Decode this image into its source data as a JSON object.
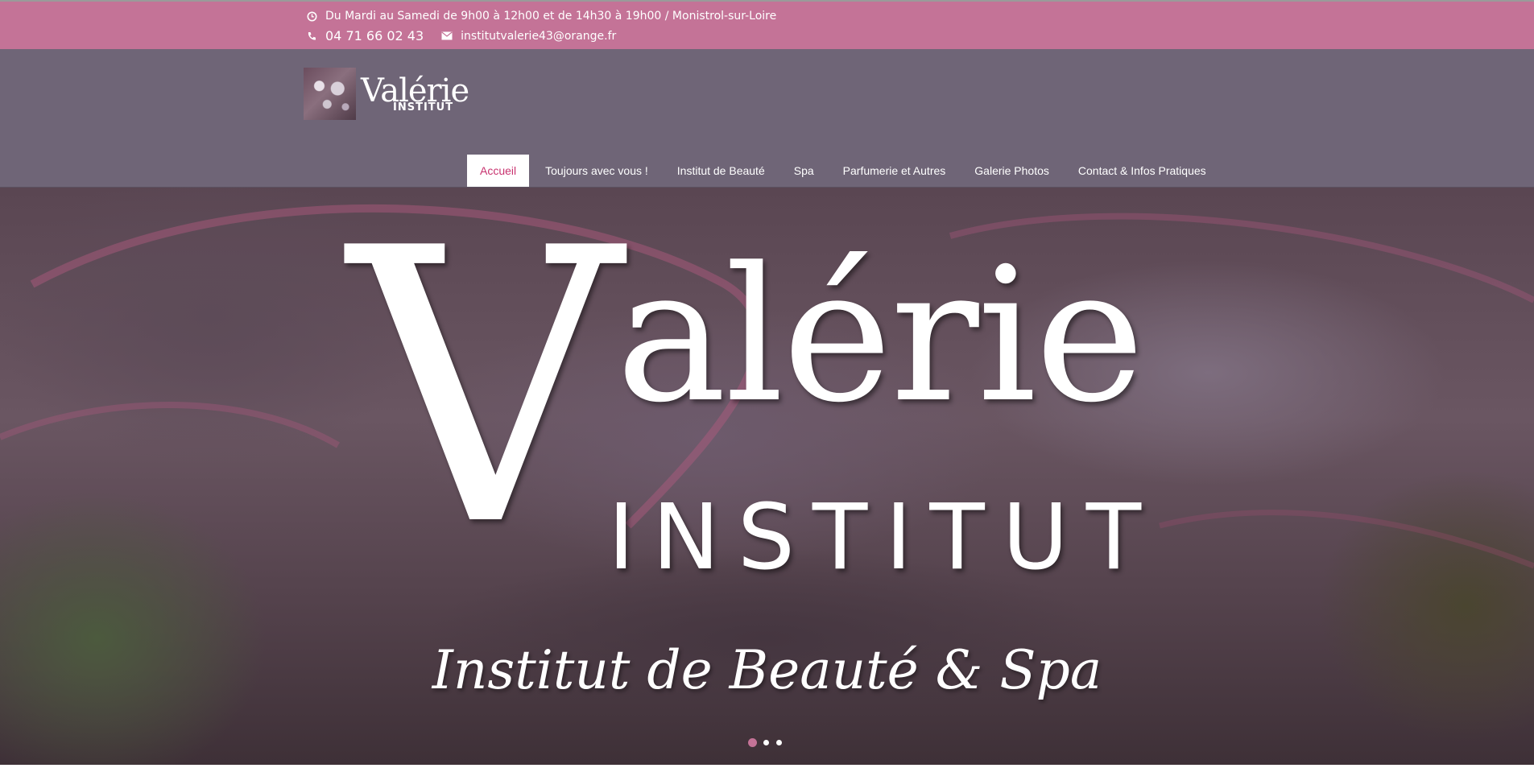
{
  "topbar": {
    "hours": "Du Mardi au Samedi de 9h00 à 12h00 et de 14h30 à 19h00 / Monistrol-sur-Loire",
    "phone": "04 71 66 02 43",
    "email": "institutvalerie43@orange.fr",
    "icons": [
      "clock-icon",
      "phone-icon",
      "envelope-icon"
    ]
  },
  "logo": {
    "name": "Valérie",
    "subtitle": "INSTITUT"
  },
  "nav": {
    "items": [
      {
        "label": "Accueil",
        "active": true
      },
      {
        "label": "Toujours avec vous !",
        "active": false
      },
      {
        "label": "Institut de Beauté",
        "active": false
      },
      {
        "label": "Spa",
        "active": false
      },
      {
        "label": "Parfumerie et Autres",
        "active": false
      },
      {
        "label": "Galerie Photos",
        "active": false
      },
      {
        "label": "Contact & Infos Pratiques",
        "active": false
      }
    ]
  },
  "hero": {
    "title_initial": "V",
    "title_rest": "alérie",
    "institut": "INSTITUT",
    "subtitle": "Institut de Beauté & Spa",
    "slides": 3,
    "active_slide": 1
  },
  "colors": {
    "accent": "#c47397",
    "header_bg": "#6f6577",
    "active_nav_text": "#c8336f"
  }
}
